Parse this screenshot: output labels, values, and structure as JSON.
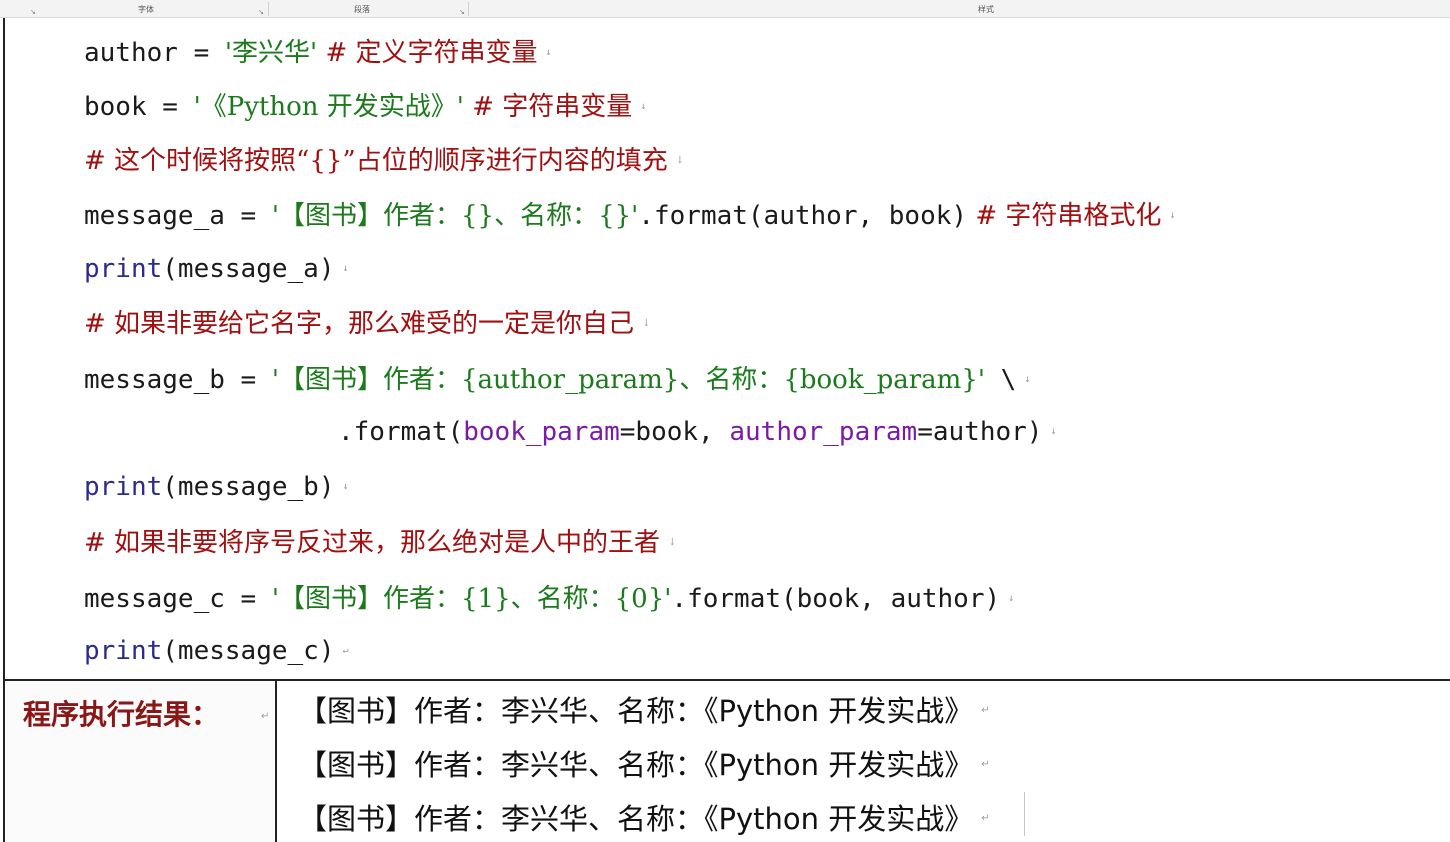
{
  "ribbon": {
    "groups": [
      "字体",
      "段落",
      "样式"
    ]
  },
  "code": {
    "line1": {
      "name": "author",
      "op": " = ",
      "str": "'李兴华'",
      "cmt": " # 定义字符串变量"
    },
    "line2": {
      "name": "book",
      "op": " = ",
      "str": "'《Python 开发实战》'",
      "cmt": " # 字符串变量"
    },
    "line3": {
      "cmt": "# 这个时候将按照“{}”占位的顺序进行内容的填充"
    },
    "line4": {
      "name": "message_a",
      "op": " = ",
      "str": "'【图书】作者：{}、名称：{}'",
      "rest": ".format(author, book)",
      "cmt": " # 字符串格式化"
    },
    "line5": {
      "kw": "print",
      "rest": "(message_a)"
    },
    "line6": {
      "cmt": "# 如果非要给它名字，那么难受的一定是你自己"
    },
    "line7": {
      "name": "message_b",
      "op": " = ",
      "str": "'【图书】作者：{author_param}、名称：{book_param}'",
      "rest": " \\"
    },
    "line8": {
      "pre": ".format(",
      "p1": "book_param",
      "mid": "=book, ",
      "p2": "author_param",
      "post": "=author)"
    },
    "line9": {
      "kw": "print",
      "rest": "(message_b)"
    },
    "line10": {
      "cmt": "# 如果非要将序号反过来，那么绝对是人中的王者"
    },
    "line11": {
      "name": "message_c",
      "op": " = ",
      "str": "'【图书】作者：{1}、名称：{0}'",
      "rest": ".format(book, author)"
    },
    "line12": {
      "kw": "print",
      "rest": "(message_c)"
    }
  },
  "result": {
    "label": "程序执行结果：",
    "lines": [
      "【图书】作者：李兴华、名称：《Python 开发实战》",
      "【图书】作者：李兴华、名称：《Python 开发实战》",
      "【图书】作者：李兴华、名称：《Python 开发实战》"
    ]
  },
  "colors": {
    "keyword": "#2b2b8f",
    "string": "#1b7a1b",
    "comment": "#a01010",
    "param": "#7a1aa8",
    "label": "#8a1616"
  }
}
